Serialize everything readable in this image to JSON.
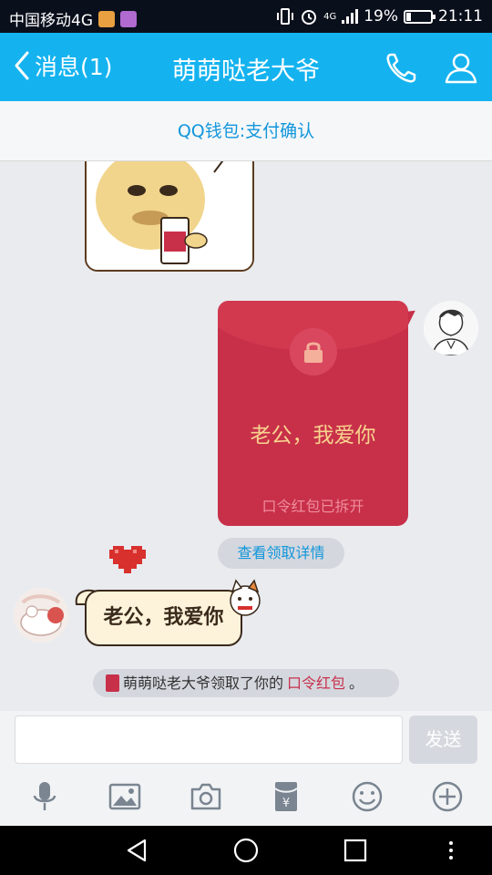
{
  "status_bar": {
    "carrier": "中国移动4G",
    "battery_percent": "19%",
    "battery_level": 0.19,
    "time": "21:11",
    "network": "4G"
  },
  "header": {
    "back_label": "消息(1)",
    "title": "萌萌哒老大爷",
    "icons": [
      "phone-icon",
      "contact-icon"
    ]
  },
  "notice": {
    "text": "QQ钱包:支付确认"
  },
  "chat": {
    "red_packet": {
      "message": "老公，我爱你",
      "status": "口令红包已拆开"
    },
    "view_details": "查看领取详情",
    "sticker_text": "老公，我爱你",
    "system_message": {
      "prefix": "萌萌哒老大爷领取了你的",
      "highlight": "口令红包",
      "suffix": "。"
    }
  },
  "input": {
    "value": "",
    "send_label": "发送"
  },
  "toolbar": {
    "icons": [
      "microphone-icon",
      "image-icon",
      "camera-icon",
      "red-packet-icon",
      "emoji-icon",
      "plus-icon"
    ]
  },
  "navbar": {
    "icons": [
      "nav-back-icon",
      "nav-home-icon",
      "nav-recents-icon",
      "nav-menu-icon"
    ]
  },
  "colors": {
    "header_bg": "#14b3ef",
    "red_packet": "#c8304a",
    "link": "#1296db"
  }
}
